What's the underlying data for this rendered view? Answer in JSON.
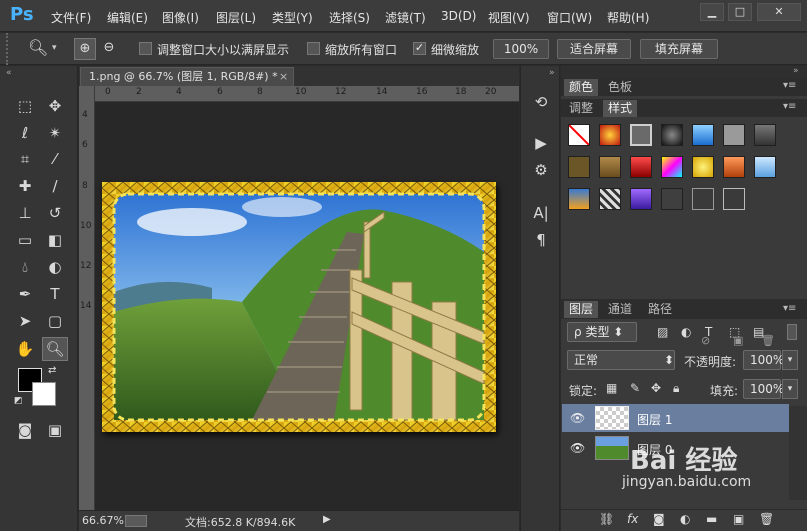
{
  "app": {
    "logo": "Ps"
  },
  "menu": [
    "文件(F)",
    "编辑(E)",
    "图像(I)",
    "图层(L)",
    "类型(Y)",
    "选择(S)",
    "滤镜(T)",
    "3D(D)",
    "视图(V)",
    "窗口(W)",
    "帮助(H)"
  ],
  "options": {
    "resize_windows": "调整窗口大小以满屏显示",
    "zoom_all": "缩放所有窗口",
    "scrubby_zoom": "细微缩放",
    "zoom_pct": "100%",
    "fit_screen": "适合屏幕",
    "fill_screen": "填充屏幕"
  },
  "document": {
    "tab_title": "1.png @ 66.7% (图层 1, RGB/8#) *",
    "close": "×",
    "ruler_top": [
      "0",
      "2",
      "4",
      "6",
      "8",
      "10",
      "12",
      "14",
      "16",
      "18",
      "20"
    ],
    "ruler_left": [
      "4",
      "6",
      "8",
      "10",
      "12",
      "14"
    ]
  },
  "status": {
    "zoom": "66.67%",
    "doc_info": "文档:652.8 K/894.6K"
  },
  "panels": {
    "color_tabs": [
      "颜色",
      "色板"
    ],
    "style_tabs": [
      "调整",
      "样式"
    ],
    "layer_tabs": [
      "图层",
      "通道",
      "路径"
    ],
    "kind_filter": "类型",
    "blend_mode": "正常",
    "opacity_label": "不透明度:",
    "opacity_value": "100%",
    "lock_label": "锁定:",
    "fill_label": "填充:",
    "fill_value": "100%",
    "layers": [
      {
        "name": "图层 1"
      },
      {
        "name": "图层 0"
      }
    ]
  },
  "watermark": {
    "text": "Bai 经验",
    "url": "jingyan.baidu.com"
  },
  "colors": {
    "accent": "#4ab3ff",
    "selected_layer": "#6a7fa0"
  }
}
